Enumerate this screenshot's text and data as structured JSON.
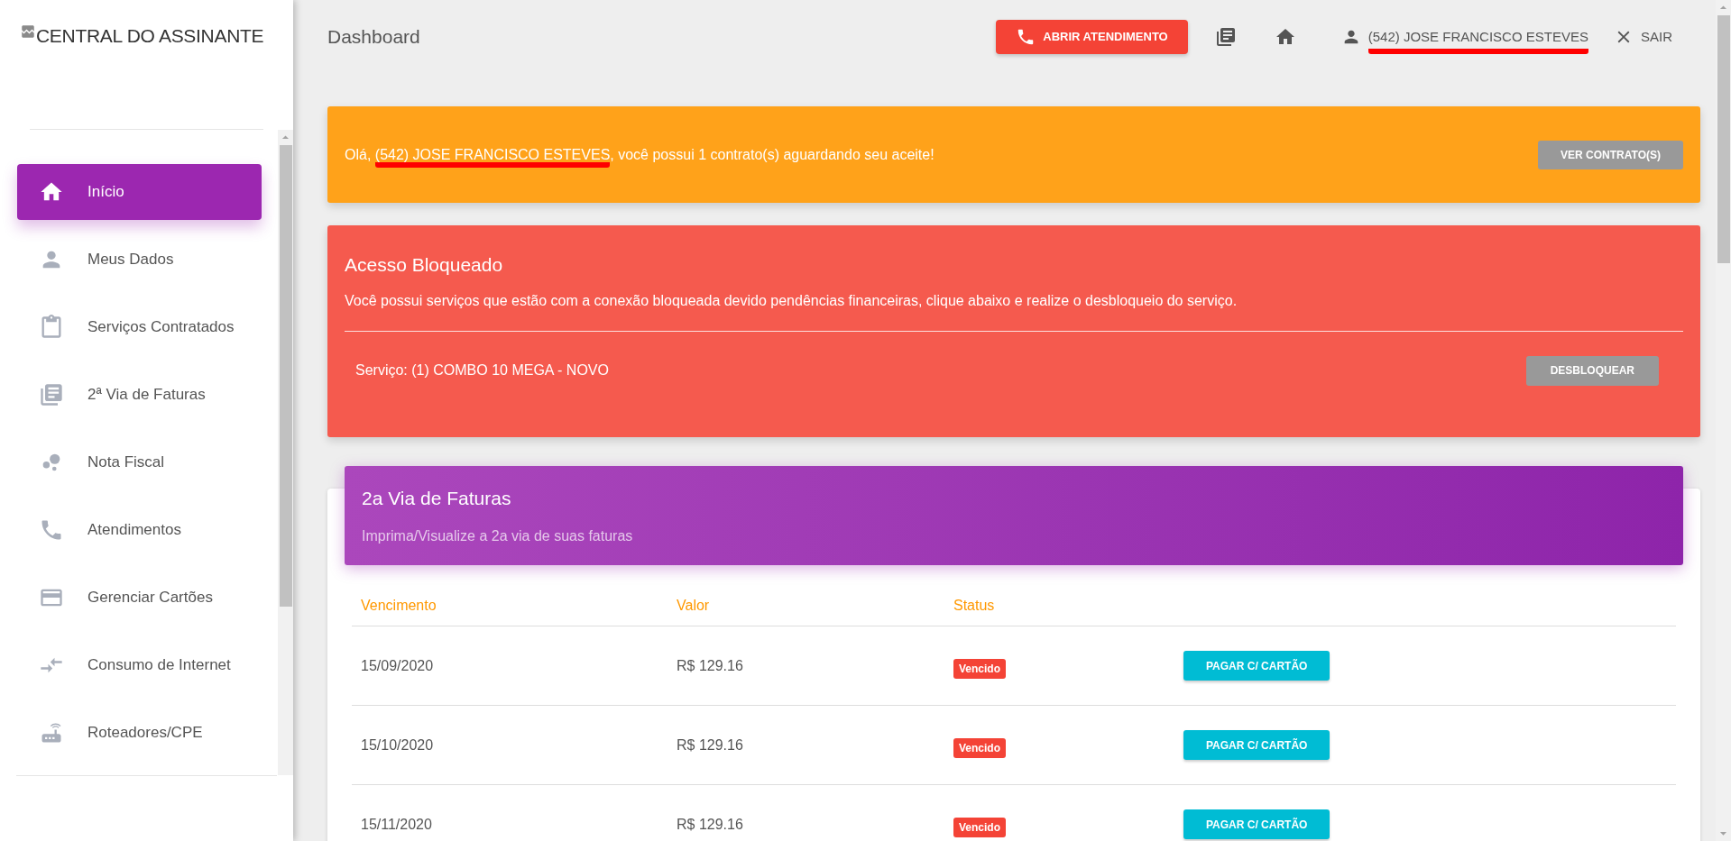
{
  "sidebar": {
    "logo_alt": "CENTRAL DO ASSINANTE",
    "items": [
      {
        "label": "Início",
        "selected": true
      },
      {
        "label": "Meus Dados",
        "selected": false
      },
      {
        "label": "Serviços Contratados",
        "selected": false
      },
      {
        "label": "2ª Via de Faturas",
        "selected": false
      },
      {
        "label": "Nota Fiscal",
        "selected": false
      },
      {
        "label": "Atendimentos",
        "selected": false
      },
      {
        "label": "Gerenciar Cartões",
        "selected": false
      },
      {
        "label": "Consumo de Internet",
        "selected": false
      },
      {
        "label": "Roteadores/CPE",
        "selected": false
      }
    ]
  },
  "header": {
    "title": "Dashboard",
    "open_ticket_button": "ABRIR ATENDIMENTO",
    "user": "(542) JOSE FRANCISCO ESTEVES",
    "user_underlined": true,
    "logout": "SAIR"
  },
  "contract_banner": {
    "greeting": "Olá, ",
    "user": "(542) JOSE FRANCISCO ESTEVES",
    "user_underlined": true,
    "message": ", você possui 1 contrato(s) aguardando seu aceite!",
    "button": "VER CONTRATO(S)"
  },
  "blocked_card": {
    "title": "Acesso Bloqueado",
    "message": "Você possui serviços que estão com a conexão bloqueada devido pendências financeiras, clique abaixo e realize o desbloqueio do serviço.",
    "service": "Serviço: (1) COMBO 10 MEGA - NOVO",
    "button": "DESBLOQUEAR"
  },
  "invoices": {
    "title": "2a Via de Faturas",
    "subtitle": "Imprima/Visualize a 2a via de suas faturas",
    "columns": [
      "Vencimento",
      "Valor",
      "Status"
    ],
    "rows": [
      {
        "due": "15/09/2020",
        "value": "R$ 129.16",
        "status": "Vencido",
        "button": "PAGAR C/ CARTÃO"
      },
      {
        "due": "15/10/2020",
        "value": "R$ 129.16",
        "status": "Vencido",
        "button": "PAGAR C/ CARTÃO"
      },
      {
        "due": "15/11/2020",
        "value": "R$ 129.16",
        "status": "Vencido",
        "button": "PAGAR C/ CARTÃO"
      }
    ]
  }
}
